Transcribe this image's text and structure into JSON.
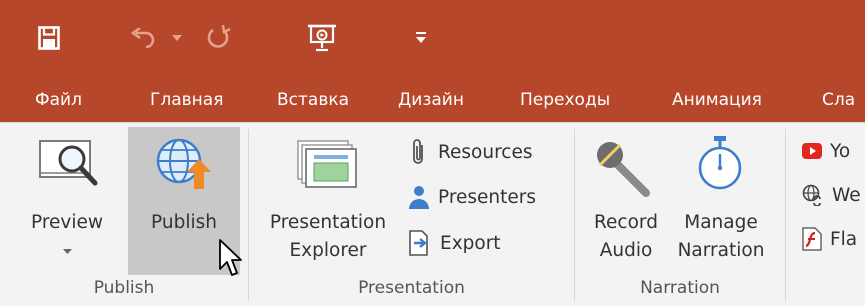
{
  "ribbon_tabs": [
    "Файл",
    "Главная",
    "Вставка",
    "Дизайн",
    "Переходы",
    "Анимация",
    "Сла"
  ],
  "groups": {
    "publish": {
      "label": "Publish",
      "preview_label": "Preview",
      "publish_label": "Publish"
    },
    "presentation": {
      "label": "Presentation",
      "explorer_line1": "Presentation",
      "explorer_line2": "Explorer",
      "resources_label": "Resources",
      "presenters_label": "Presenters",
      "export_label": "Export"
    },
    "narration": {
      "label": "Narration",
      "record_line1": "Record",
      "record_line2": "Audio",
      "manage_line1": "Manage",
      "manage_line2": "Narration"
    },
    "insert": {
      "youtube_label": "Yo",
      "web_label": "We",
      "flash_label": "Fla"
    }
  },
  "icons": [
    "save-icon",
    "undo-icon",
    "undo-dropdown-icon",
    "redo-icon",
    "present-icon",
    "customize-qat-icon",
    "preview-icon",
    "publish-icon",
    "presentation-explorer-icon",
    "resources-icon",
    "presenters-icon",
    "export-icon",
    "microphone-icon",
    "stopwatch-icon",
    "youtube-icon",
    "web-object-icon",
    "flash-icon",
    "mouse-cursor-icon"
  ],
  "colors": {
    "title_bar": "#b7472a",
    "ribbon_bg": "#f3f3f3",
    "highlight": "#c8c8c8",
    "accent_orange": "#f08a24",
    "blue": "#3e7dc8"
  }
}
